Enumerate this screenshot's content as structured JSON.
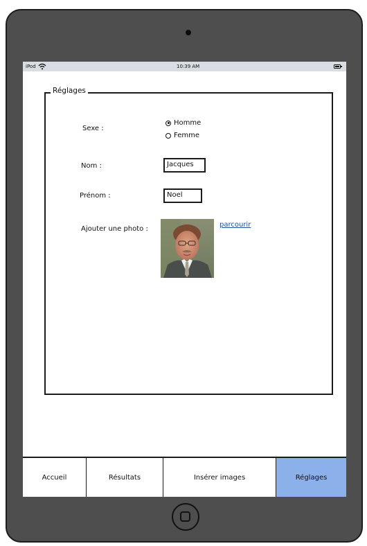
{
  "status_bar": {
    "carrier": "iPod",
    "time": "10:39 AM"
  },
  "settings_panel": {
    "legend": "Réglages",
    "sexe": {
      "label": "Sexe :",
      "options": [
        {
          "label": "Homme",
          "selected": true
        },
        {
          "label": "Femme",
          "selected": false
        }
      ]
    },
    "nom": {
      "label": "Nom :",
      "value": "Jacques"
    },
    "prenom": {
      "label": "Prénom :",
      "value": "Noel"
    },
    "photo": {
      "label": "Ajouter une photo :",
      "browse_link": "parcourir"
    }
  },
  "tabs": [
    {
      "label": "Accueil",
      "active": false
    },
    {
      "label": "Résultats",
      "active": false
    },
    {
      "label": "Insérer images",
      "active": false
    },
    {
      "label": "Réglages",
      "active": true
    }
  ],
  "colors": {
    "active_tab": "#8cb0ea",
    "device_frame": "#4e4e4e",
    "status_bar": "#d7dde3",
    "link": "#1a4e9c"
  },
  "icons": {
    "wifi": "wifi-icon",
    "battery": "battery-icon",
    "camera": "camera-icon",
    "home": "home-button-icon",
    "radio": "radio-icon"
  }
}
